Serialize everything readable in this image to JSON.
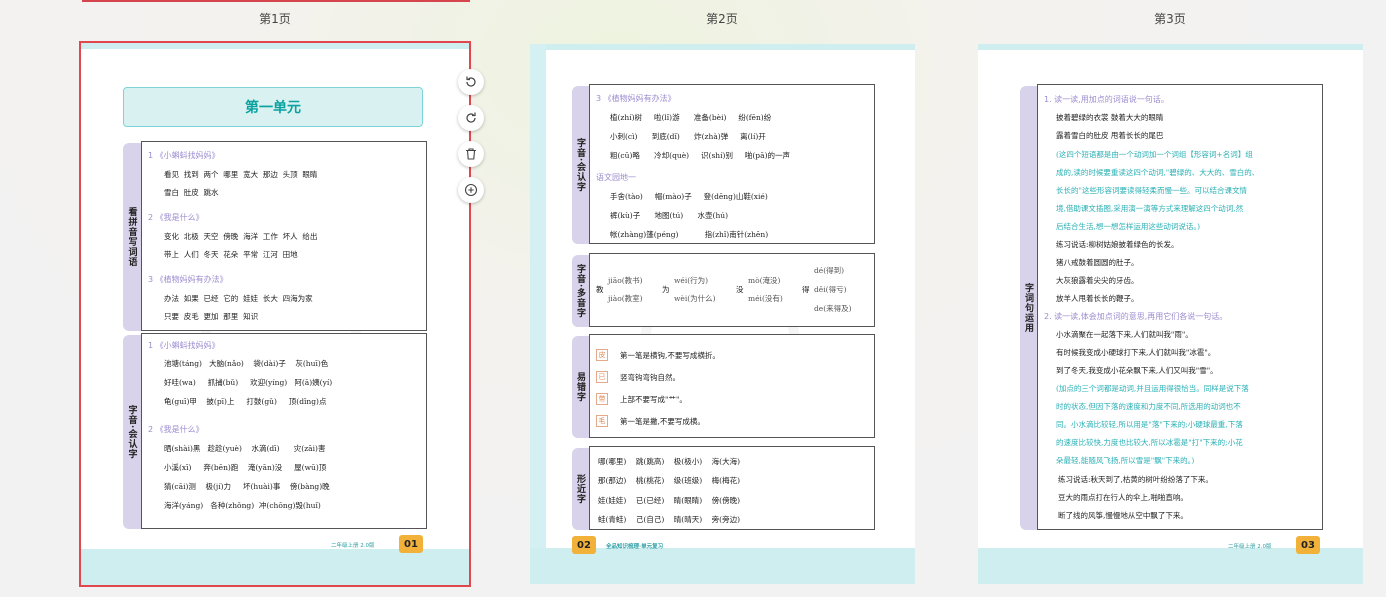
{
  "page_labels": [
    "第1页",
    "第2页",
    "第3页"
  ],
  "page1": {
    "unit_title": "第一单元",
    "tab1": "看拼音写词语",
    "tab2": "字音·会认字",
    "s1": {
      "h1": "1 《小蝌蚪找妈妈》",
      "r1": "看见  找到  两个  哪里  宽大  那边  头顶  眼睛",
      "r2": "雪白  肚皮  跳水",
      "h2": "2 《我是什么》",
      "r3": "变化  北极  天空  傍晚  海洋  工作  坏人  给出",
      "r4": "带上  人们  冬天  花朵  平常  江河  田地",
      "h3": "3 《植物妈妈有办法》",
      "r5": "办法  如果  已经  它的  娃娃  长大  四海为家",
      "r6": "只要  皮毛  更加  那里  知识"
    },
    "s2": {
      "h1": "1 《小蝌蚪找妈妈》",
      "r1": "池塘(táng)   大脑(nǎo)    袋(dài)子    灰(huī)色",
      "r2": "好哇(wa)     抓捕(bǔ)     欢迎(yíng)   阿(ā)姨(yí)",
      "r3": "龟(guī)甲    披(pī)上     打鼓(gǔ)     顶(dǐng)点",
      "h2": "2 《我是什么》",
      "r4": "晒(shài)黑   趁趁(yuè)    水滴(dī)      灾(zāi)害",
      "r5": "小溪(xī)     奔(bēn)跑    淹(yān)没     屋(wū)顶",
      "r6": "猜(cāi)测    极(jí)力     坏(huài)事    傍(bàng)晚",
      "r7": "海洋(yáng)   各种(zhǒng)  冲(chōng)毁(huǐ)"
    },
    "footer": "二年级上册  2.0版",
    "num": "01"
  },
  "page2": {
    "tab1": "字音·会认字",
    "tab2": "字音·多音字",
    "tab3": "易错字",
    "tab4": "形近字",
    "s1": {
      "h1": "3 《植物妈妈有办法》",
      "r1": "植(zhí)树     啦(lǐ)游      准备(bèi)     纷(fēn)纷",
      "r2": "小刺(cì)      到底(dǐ)      炸(zhà)弹     离(lí)开",
      "r3": "粗(cū)略      冷却(què)     识(shí)别     啪(pā)的一声",
      "h2": "语文园地一",
      "r4": "手舍(tào)     帽(mào)子     登(dēng)山鞋(xié)",
      "r5": "裤(kù)子      地图(tú)      水壶(hú)",
      "r6": "帐(zhàng)篷(péng)           指(zhǐ)南针(zhēn)"
    },
    "s2": {
      "c1": "教",
      "c1a": "jiāo(教书)",
      "c1b": "jiào(教室)",
      "c2": "为",
      "c2a": "wéi(行为)",
      "c2b": "wèi(为什么)",
      "c3": "没",
      "c3a": "mò(淹没)",
      "c3b": "méi(没有)",
      "c4": "得",
      "c4a": "dé(得到)",
      "c4b": "děi(得亏)",
      "c4c": "de(来得及)"
    },
    "s3": {
      "k1": "皮",
      "t1": "第一笔是横钩,不要写成横折。",
      "k2": "已",
      "t2": "竖弯钩弯钩自然。",
      "k3": "带",
      "t3": "上部不要写成\"艹\"。",
      "k4": "毛",
      "t4": "第一笔是撇,不要写成横。"
    },
    "s4": {
      "r1": "哪(哪里)    跳(跳高)    极(极小)    海(大海)",
      "r2": "那(那边)    桃(桃花)    级(班级)    梅(梅花)",
      "r3": "娃(娃娃)    已(已经)    睛(眼睛)    傍(傍晚)",
      "r4": "蛙(青蛙)    己(自己)    晴(晴天)    旁(旁边)"
    },
    "num": "02",
    "footer": "全品知识梳理·单元复习"
  },
  "page3": {
    "tab": "字词句运用",
    "q1": "1. 读一读,用加点的词语说一句话。",
    "l1": "披着碧绿的衣裳       鼓着大大的眼睛",
    "l2": "露着雪白的肚皮       甩着长长的尾巴",
    "t1": "(这四个短语都是由一个动词加一个词组【形容词+名词】组",
    "t2": "成的,读的时候要重读这四个动词,\"碧绿的、大大的、雪白的、",
    "t3": "长长的\"这些形容词要读得轻柔而慢一些。可以结合课文情",
    "t4": "境,借助课文插图,采用演一演等方式来理解这四个动词,然",
    "t5": "后结合生活,想一想怎样运用这些动词说话。)",
    "p1": "练习说话:柳树姑娘披着绿色的长发。",
    "p2": "猪八戒鼓着圆圆的肚子。",
    "p3": "大灰狼露着尖尖的牙齿。",
    "p4": "放羊人甩着长长的鞭子。",
    "q2": "2. 读一读,体会加点词的意思,再用它们各说一句话。",
    "m1": "小水滴聚在一起落下来,人们就叫我\"雨\"。",
    "m2": "有时候我变成小硬球打下来,人们就叫我\"冰雹\"。",
    "m3": "到了冬天,我变成小花朵飘下来,人们又叫我\"雪\"。",
    "u1": "(加点的三个词都是动词,并且运用得很恰当。同样是说下落",
    "u2": "时的状态,但因下落的速度和力度不同,所选用的动词也不",
    "u3": "同。小水滴比较轻,所以用是\"落\"下来的;小硬球最重,下落",
    "u4": "的速度比较快,力度也比较大,所以冰雹是\"打\"下来的;小花",
    "u5": "朵最轻,能随风飞扬,所以雪是\"飘\"下来的。)",
    "e1": "练习说话:秋天到了,枯黄的树叶纷纷落了下来。",
    "e2": "豆大的雨点打在行人的伞上,啪啪直响。",
    "e3": "断了线的风筝,慢慢地从空中飘了下来。",
    "footer": "二年级上册  2.0版",
    "num": "03"
  },
  "tools": [
    "rotate-left-icon",
    "rotate-right-icon",
    "trash-icon",
    "add-icon"
  ]
}
